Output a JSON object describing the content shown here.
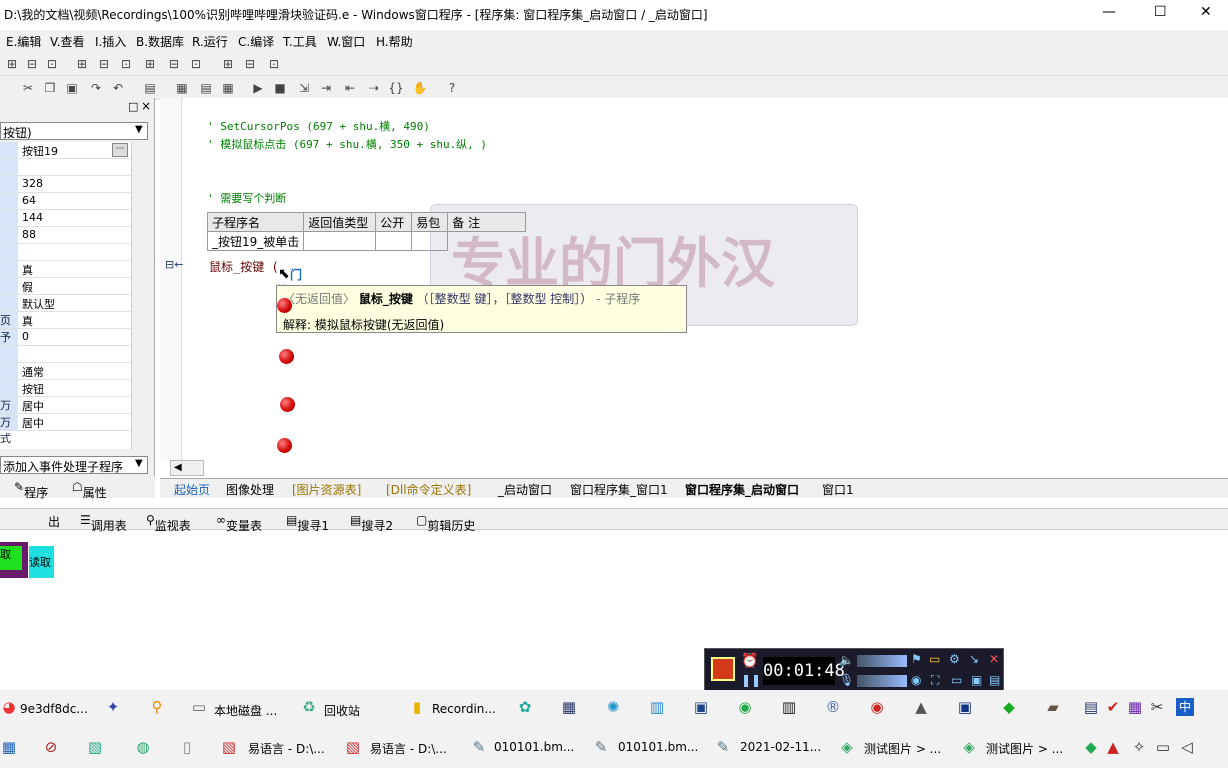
{
  "window": {
    "title": "D:\\我的文档\\视频\\Recordings\\100%识别哔哩哔哩滑块验证码.e - Windows窗口程序 - [程序集: 窗口程序集_启动窗口 / _启动窗口]",
    "min": "—",
    "max": "☐",
    "close": "✕"
  },
  "menu": [
    "E.编辑",
    "V.查看",
    "I.插入",
    "B.数据库",
    "R.运行",
    "C.编译",
    "T.工具",
    "W.窗口",
    "H.帮助"
  ],
  "props": {
    "panel_pin": "□",
    "panel_close": "×",
    "combo": "按钮)",
    "rows": [
      {
        "k": "",
        "v": "按钮19"
      },
      {
        "k": "",
        "v": ""
      },
      {
        "k": "",
        "v": "328"
      },
      {
        "k": "",
        "v": "64"
      },
      {
        "k": "",
        "v": "144"
      },
      {
        "k": "",
        "v": "88"
      },
      {
        "k": "",
        "v": ""
      },
      {
        "k": "",
        "v": "真"
      },
      {
        "k": "",
        "v": "假"
      },
      {
        "k": "",
        "v": "默认型"
      },
      {
        "k": "页",
        "v": "真"
      },
      {
        "k": "予",
        "v": "0"
      },
      {
        "k": "",
        "v": ""
      },
      {
        "k": "",
        "v": "通常"
      },
      {
        "k": "",
        "v": "按钮"
      },
      {
        "k": "万式",
        "v": "居中"
      },
      {
        "k": "万式",
        "v": "居中"
      }
    ],
    "event_combo": "添加入事件处理子程序",
    "tab_program": "程序",
    "tab_props": "属性"
  },
  "code": {
    "line1": "' SetCursorPos (697 + shu.横, 490)",
    "line2": "' 模拟鼠标点击 (697 + shu.横, 350 + shu.纵, )",
    "line3": "' 需要写个判断",
    "table_headers": [
      "子程序名",
      "返回值类型",
      "公开",
      "易包",
      "备 注"
    ],
    "table_row": [
      "_按钮19_被单击",
      "",
      "",
      "",
      ""
    ],
    "line4": "鼠标_按键 (",
    "gutter": "⊟←"
  },
  "watermark": "专业的门外汉",
  "cursor_text": {
    "a": "门",
    "b": "外汉"
  },
  "tooltip": {
    "prefix": "〈无返回值〉",
    "name": "鼠标_按键",
    "params": " （［整数型 键］，［整数型 控制］） ",
    "kind": "- 子程序",
    "desc_label": "解释:",
    "desc": "模拟鼠标按键(无返回值)"
  },
  "editor_tabs": [
    "起始页",
    "图像处理",
    "[图片资源表]",
    "[Dll命令定义表]",
    "_启动窗口",
    "窗口程序集_窗口1",
    "窗口程序集_启动窗口",
    "窗口1"
  ],
  "output_tabs": [
    "出",
    "调用表",
    "监视表",
    "变量表",
    "搜寻1",
    "搜寻2",
    "剪辑历史"
  ],
  "buttons": {
    "green": "取",
    "cyan": "读取"
  },
  "recorder": {
    "time": "00:01:48"
  },
  "taskbar_top": [
    "9e3df8dc...",
    "本地磁盘 ...",
    "回收站",
    "Recordin..."
  ],
  "taskbar_bottom": [
    "易语言 - D:\\...",
    "易语言 - D:\\...",
    "010101.bm...",
    "010101.bm...",
    "2021-02-11...",
    "测试图片 > ...",
    "测试图片 > ..."
  ],
  "tray_lang": "中"
}
